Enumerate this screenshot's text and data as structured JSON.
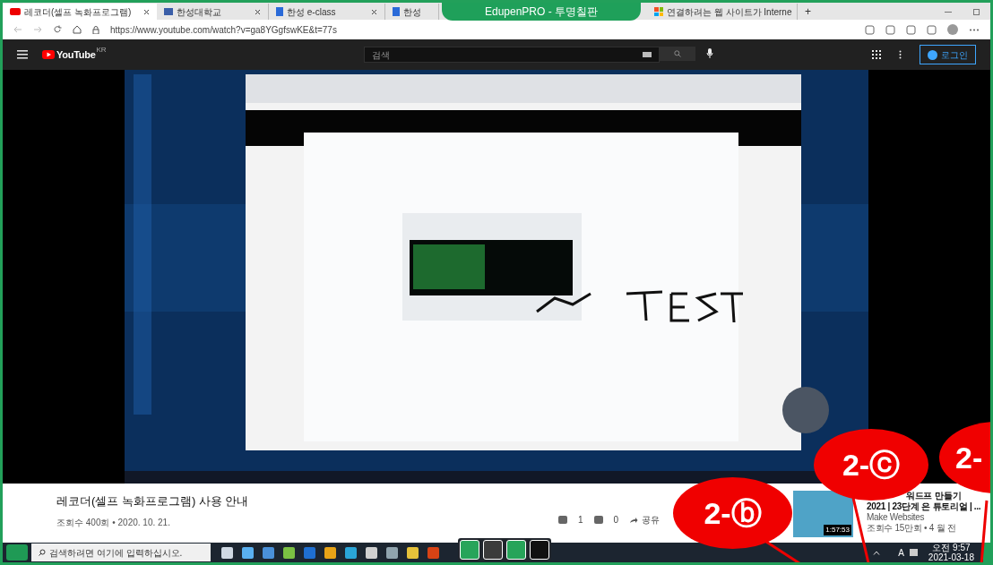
{
  "browser": {
    "tabs": [
      {
        "label": "레코더(셀프 녹화프로그램)",
        "selected": true,
        "kind": "youtube"
      },
      {
        "label": "한성대학교",
        "selected": false,
        "kind": "school"
      },
      {
        "label": "한성 e-class",
        "selected": false,
        "kind": "eclass"
      },
      {
        "label": "한성",
        "selected": false,
        "kind": "eclass"
      },
      {
        "label": "연결하려는 웹 사이트가 Interne",
        "selected": false,
        "kind": "ms"
      }
    ],
    "new_tab": "+",
    "address": "https://www.youtube.com/watch?v=ga8YGgfswKE&t=77s"
  },
  "overlay_title": "EdupenPRO - 투명칠판",
  "youtube": {
    "logo": "YouTube",
    "region": "KR",
    "search_placeholder": "검색",
    "login": "로그인"
  },
  "info": {
    "title": "레코더(셀프 녹화프로그램) 사용 안내",
    "meta": "조회수 400회 • 2020. 10. 21.",
    "likes": "1",
    "dislikes": "0",
    "share": "공유"
  },
  "recommended": {
    "lines": [
      [
        "워드프",
        "만들기"
      ],
      [
        "2021 | 23단계",
        "은 튜토리얼 | ..."
      ],
      [
        "Make Websites"
      ],
      [
        "조회수 15만회 • 4",
        "월 전"
      ]
    ],
    "duration": "1:57:53"
  },
  "taskbar": {
    "search_placeholder": "검색하려면 여기에 입력하십시오.",
    "ime": "A",
    "time": "오전 9:57",
    "date": "2021-03-18"
  },
  "annotations": [
    {
      "label": "2-ⓑ"
    },
    {
      "label": "2-ⓒ"
    },
    {
      "label": "2-"
    }
  ]
}
